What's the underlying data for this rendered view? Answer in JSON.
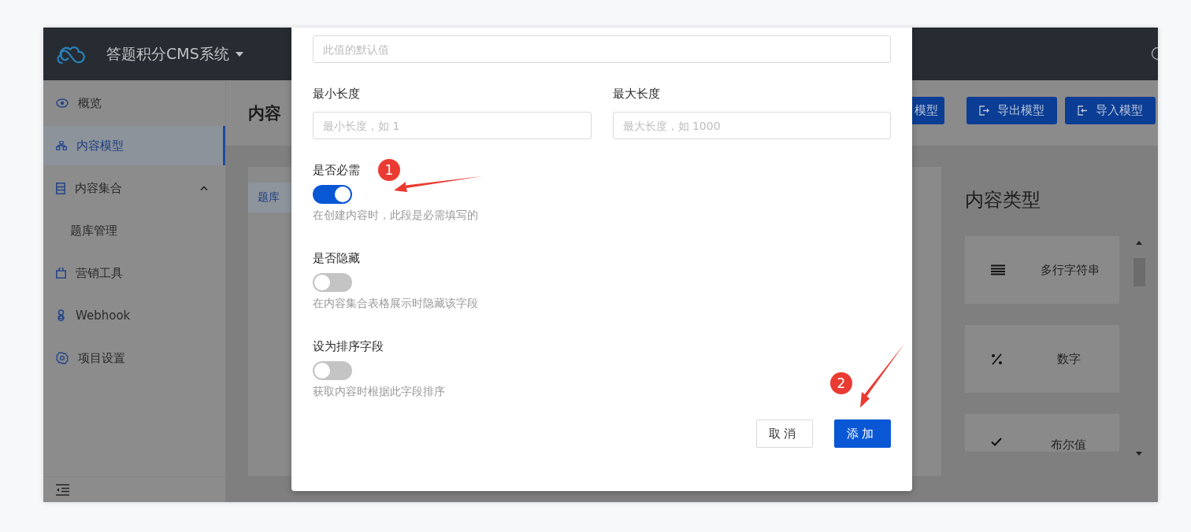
{
  "header": {
    "title": "答题积分CMS系统"
  },
  "sidebar": {
    "items": [
      {
        "label": "概览",
        "selected": false
      },
      {
        "label": "内容模型",
        "selected": true
      },
      {
        "label": "内容集合",
        "selected": false,
        "expanded": true,
        "children": [
          {
            "label": "题库管理",
            "selected": false
          }
        ]
      },
      {
        "label": "营销工具",
        "selected": false
      },
      {
        "label": "Webhook",
        "selected": false
      },
      {
        "label": "项目设置",
        "selected": false
      }
    ]
  },
  "page": {
    "title": "内容",
    "toolbar": [
      "模型",
      "导出模型",
      "导入模型"
    ],
    "tabs": [
      {
        "label": "题库",
        "selected": true
      }
    ]
  },
  "content_types": {
    "title": "内容类型",
    "items": [
      {
        "label": "多行字符串"
      },
      {
        "label": "数字"
      },
      {
        "label": "布尔值"
      }
    ]
  },
  "dialog": {
    "default_value": {
      "placeholder": "此值的默认值"
    },
    "min_length": {
      "label": "最小长度",
      "placeholder": "最小长度，如 1"
    },
    "max_length": {
      "label": "最大长度",
      "placeholder": "最大长度，如 1000"
    },
    "switches": [
      {
        "label": "是否必需",
        "on": true,
        "description": "在创建内容时，此段是必需填写的"
      },
      {
        "label": "是否隐藏",
        "on": false,
        "description": "在内容集合表格展示时隐藏该字段"
      },
      {
        "label": "设为排序字段",
        "on": false,
        "description": "获取内容时根据此字段排序"
      }
    ],
    "buttons": [
      {
        "label": "取消",
        "kind": "default"
      },
      {
        "label": "添加",
        "kind": "primary"
      }
    ]
  },
  "annotations": [
    {
      "number": "1"
    },
    {
      "number": "2"
    }
  ]
}
